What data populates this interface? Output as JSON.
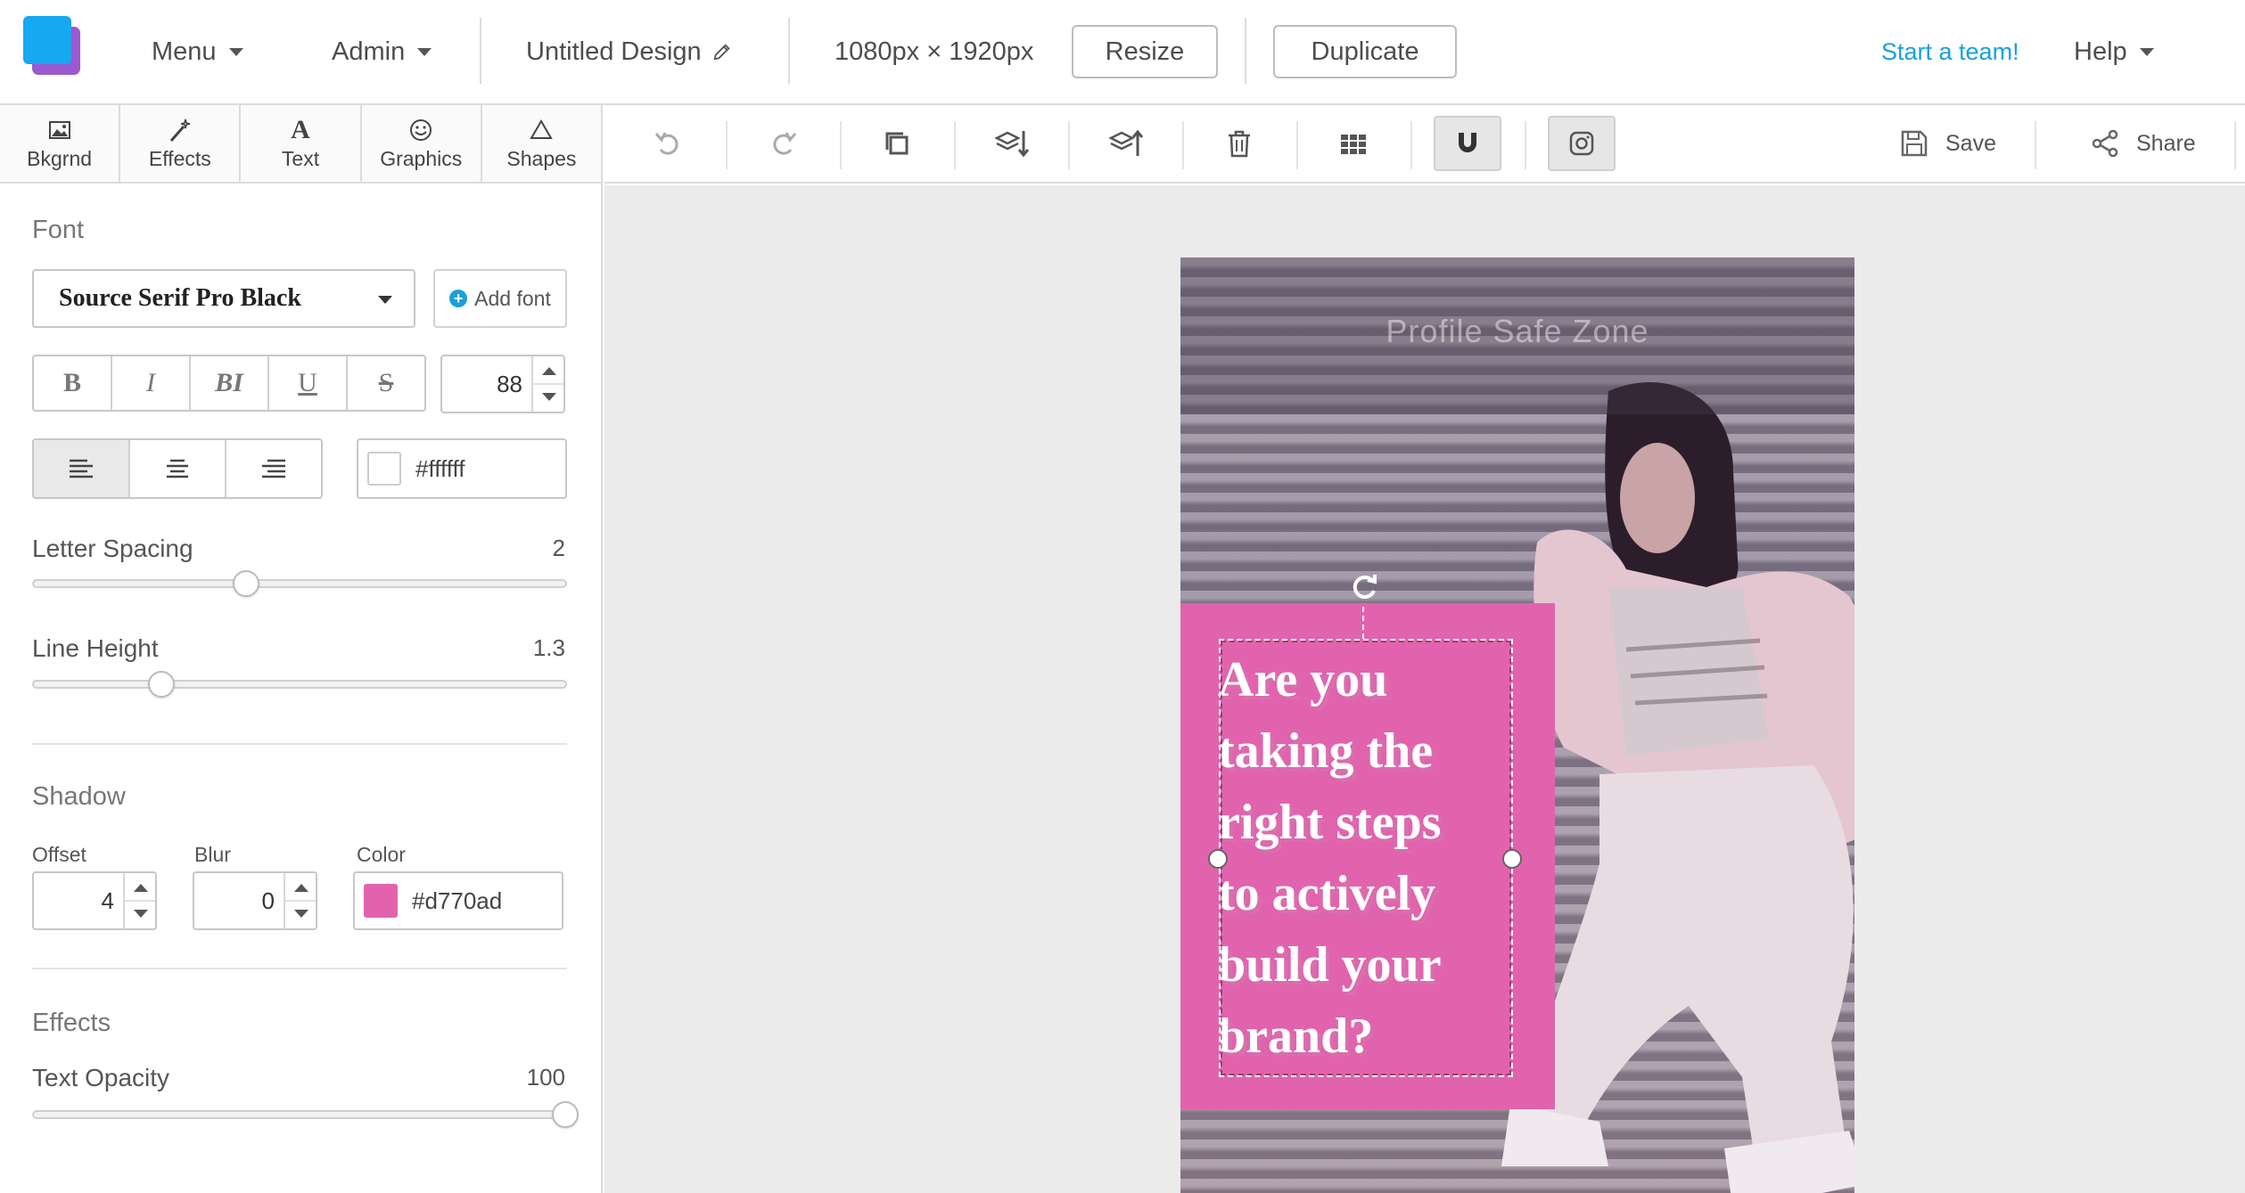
{
  "topbar": {
    "menu_label": "Menu",
    "admin_label": "Admin",
    "design_title": "Untitled Design",
    "dimensions": "1080px × 1920px",
    "resize_label": "Resize",
    "duplicate_label": "Duplicate",
    "start_team_label": "Start a team!",
    "help_label": "Help"
  },
  "tooltabs": {
    "bkgrnd": "Bkgrnd",
    "effects": "Effects",
    "text": "Text",
    "graphics": "Graphics",
    "shapes": "Shapes"
  },
  "actionbar": {
    "save_label": "Save",
    "share_label": "Share"
  },
  "panel": {
    "font_section": "Font",
    "font_name": "Source Serif Pro Black",
    "add_font_label": "Add font",
    "style_buttons": [
      "B",
      "I",
      "BI",
      "U",
      "S"
    ],
    "font_size": "88",
    "text_color_hex": "#ffffff",
    "letter_spacing_label": "Letter Spacing",
    "letter_spacing_value": "2",
    "letter_spacing_fraction": 0.4,
    "line_height_label": "Line Height",
    "line_height_value": "1.3",
    "line_height_fraction": 0.24,
    "shadow_section": "Shadow",
    "offset_label": "Offset",
    "offset_value": "4",
    "blur_label": "Blur",
    "blur_value": "0",
    "color_label": "Color",
    "shadow_color_hex": "#d770ad",
    "effects_section": "Effects",
    "text_opacity_label": "Text Opacity",
    "text_opacity_value": "100",
    "text_opacity_fraction": 1.0
  },
  "canvas": {
    "safe_zone_label": "Profile Safe Zone",
    "headline": "Are you\ntaking the\nright steps\nto actively\nbuild your\nbrand?"
  },
  "colors": {
    "accent": "#1aa1d8",
    "logo_blue": "#16a8f0",
    "logo_purple": "#9b59d0",
    "pink_box": "#e263ad",
    "shadow_color": "#d770ad",
    "text_color": "#ffffff"
  },
  "icons": [
    "image-icon",
    "wand-icon",
    "text-icon",
    "smiley-icon",
    "triangle-icon",
    "undo-icon",
    "redo-icon",
    "copy-icon",
    "layer-down-icon",
    "layer-up-icon",
    "trash-icon",
    "grid-icon",
    "magnet-icon",
    "instagram-icon",
    "save-icon",
    "share-icon",
    "pencil-icon",
    "rotate-icon"
  ]
}
